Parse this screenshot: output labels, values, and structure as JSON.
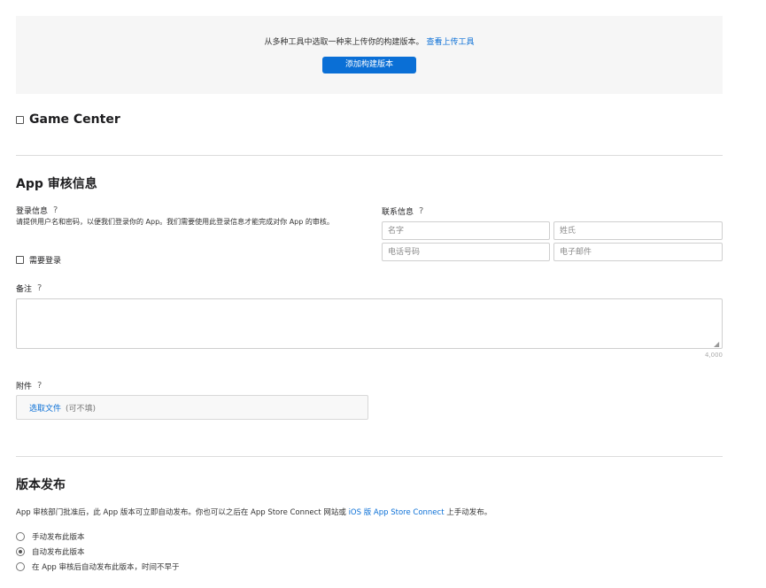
{
  "build": {
    "text": "从多种工具中选取一种来上传你的构建版本。",
    "link": "查看上传工具",
    "button": "添加构建版本"
  },
  "game_center": {
    "title": "Game Center",
    "checked": false
  },
  "review": {
    "title": "App 审核信息",
    "login": {
      "label": "登录信息",
      "help": "?",
      "description": "请提供用户名和密码，以便我们登录你的 App。我们需要使用此登录信息才能完成对你 App 的审核。",
      "require_label": "需要登录"
    },
    "contact": {
      "label": "联系信息",
      "help": "?",
      "first_name_placeholder": "名字",
      "last_name_placeholder": "姓氏",
      "phone_placeholder": "电话号码",
      "email_placeholder": "电子邮件"
    },
    "notes": {
      "label": "备注",
      "help": "?",
      "counter": "4,000"
    },
    "attachment": {
      "label": "附件",
      "help": "?",
      "choose": "选取文件",
      "hint": "(可不填)"
    }
  },
  "release": {
    "title": "版本发布",
    "description": "App 审核部门批准后，此 App 版本可立即自动发布。你也可以之后在 App Store Connect 网站或",
    "description_link": "iOS 版 App Store Connect",
    "description_tail": "上手动发布。",
    "options": [
      {
        "label": "手动发布此版本",
        "selected": false
      },
      {
        "label": "自动发布此版本",
        "selected": true
      },
      {
        "label": "在 App 审核后自动发布此版本，时间不早于",
        "selected": false
      }
    ]
  }
}
